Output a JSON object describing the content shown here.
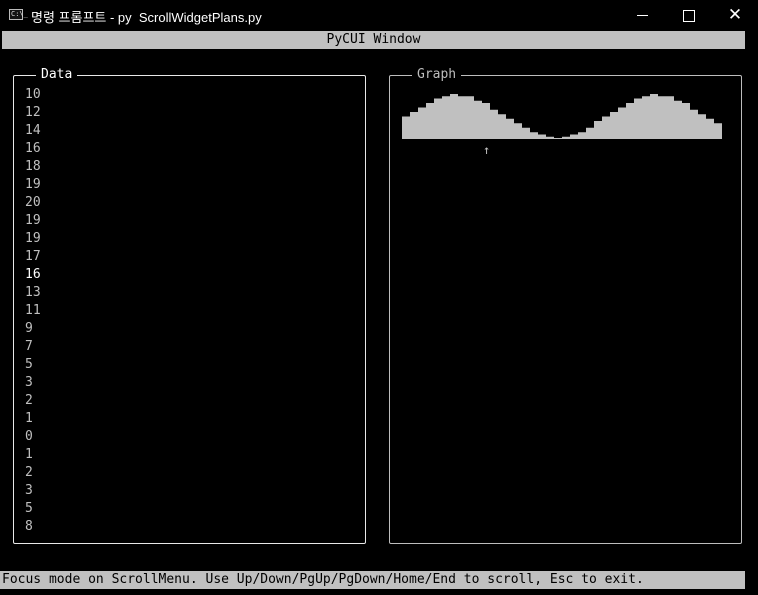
{
  "window": {
    "title": "명령 프롬프트 - py  ScrollWidgetPlans.py",
    "icon": "cmd-icon",
    "icon_text": "C:\\_"
  },
  "header": {
    "title": "PyCUI Window"
  },
  "data_panel": {
    "title": "Data",
    "items": [
      "10",
      "12",
      "14",
      "16",
      "18",
      "19",
      "20",
      "19",
      "19",
      "17",
      "16",
      "13",
      "11",
      "9",
      "7",
      "5",
      "3",
      "2",
      "1",
      "0",
      "1",
      "2",
      "3",
      "5",
      "8"
    ],
    "selected_index": 10
  },
  "graph_panel": {
    "title": "Graph",
    "marker": "↑"
  },
  "status_bar": {
    "text": "Focus mode on ScrollMenu. Use Up/Down/PgUp/PgDown/Home/End to scroll, Esc to exit."
  },
  "colors": {
    "background": "#000000",
    "bar_fill": "#c0c0c0",
    "text": "#c0c0c0",
    "highlight_text": "#ffffff"
  },
  "chart_data": {
    "type": "area",
    "values": [
      10,
      12,
      14,
      16,
      18,
      19,
      20,
      19,
      19,
      17,
      16,
      13,
      11,
      9,
      7,
      5,
      3,
      2,
      1,
      0,
      1,
      2,
      3,
      5,
      8,
      10,
      12,
      14,
      16,
      18,
      19,
      20,
      19,
      19,
      17,
      16,
      13,
      11,
      9,
      7
    ],
    "ylim": [
      0,
      20
    ],
    "marker_index": 10
  }
}
